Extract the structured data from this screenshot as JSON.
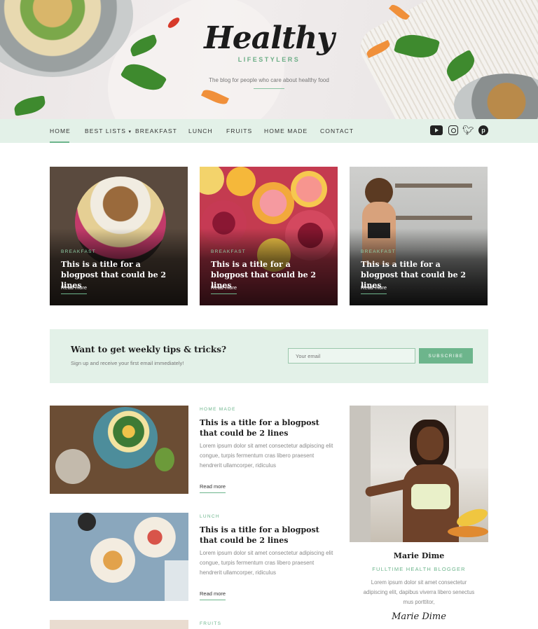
{
  "header": {
    "logo_main": "Healthy",
    "logo_sub": "LIFESTYLERS",
    "tagline": "The blog for people who care about healthy food"
  },
  "nav": {
    "items": [
      "HOME",
      "BEST LISTS",
      "BREAKFAST",
      "LUNCH",
      "FRUITS",
      "HOME MADE",
      "CONTACT"
    ],
    "best_lists_caret": "▾",
    "active": "HOME",
    "social": [
      "youtube-icon",
      "instagram-icon",
      "twitter-icon",
      "pinterest-icon"
    ]
  },
  "featured": [
    {
      "category": "BREAKFAST",
      "title": "This is a title for a blogpost that could be 2 lines",
      "more": "Read more"
    },
    {
      "category": "BREAKFAST",
      "title": "This is a title for a blogpost that could be 2 lines",
      "more": "Read more"
    },
    {
      "category": "BREAKFAST",
      "title": "This is a title for a blogpost that could be 2 lines",
      "more": "Read more"
    }
  ],
  "newsletter": {
    "title": "Want to get weekly tips & tricks?",
    "subtitle": "Sign up and receive your first email immediately!",
    "placeholder": "Your email",
    "button": "SUBSCRIBE"
  },
  "posts": [
    {
      "category": "HOME MADE",
      "title": "This is a title for a blogpost that could be 2 lines",
      "excerpt": "Lorem ipsum dolor sit amet consectetur adipiscing elit congue, turpis fermentum cras libero praesent hendrerit ullamcorper, ridiculus",
      "more": "Read more"
    },
    {
      "category": "LUNCH",
      "title": "This is a title for a blogpost that could be 2 lines",
      "excerpt": "Lorem ipsum dolor sit amet consectetur adipiscing elit congue, turpis fermentum cras libero praesent hendrerit ullamcorper, ridiculus",
      "more": "Read more"
    },
    {
      "category": "FRUITS"
    }
  ],
  "profile": {
    "name": "Marie Dime",
    "role": "FULLTIME HEALTH BLOGGER",
    "bio": "Lorem ipsum dolor sit amet consectetur adipiscing elit, dapibus viverra libero senectus mus porttitor,",
    "signature": "Marie Dime"
  },
  "colors": {
    "accent": "#6db58c",
    "nav_bg": "#e3f1e8",
    "text": "#2b2b2b"
  }
}
